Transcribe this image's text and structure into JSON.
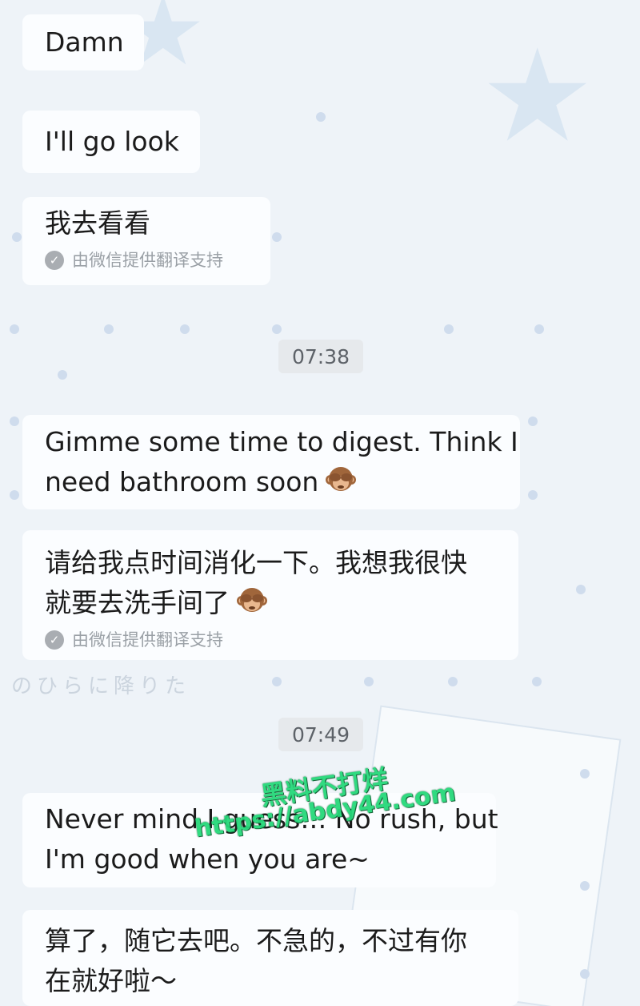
{
  "messages": {
    "m1": "Damn",
    "m2": "I'll go look",
    "m3": "我去看看",
    "m4_line1": "Gimme some time to digest. Think I",
    "m4_line2": "need bathroom soon",
    "m5_line1": "请给我点时间消化一下。我想我很快",
    "m5_line2": "就要去洗手间了",
    "m6_line1": "Never mind I guess… No rush, but",
    "m6_line2": "I'm good when you are~",
    "m7_line1": "算了，随它去吧。不急的，不过有你",
    "m7_line2": "在就好啦～"
  },
  "translation_note": "由微信提供翻译支持",
  "timestamps": {
    "t1": "07:38",
    "t2": "07:49"
  },
  "emoji": {
    "name": "see-no-evil-monkey"
  },
  "background_text": "のひらに降りた",
  "watermark": {
    "line1": "黑料不打烊",
    "line2": "https://abdy44.com"
  },
  "colors": {
    "bubble": "#fbfdff",
    "watermark": "#26d97a"
  }
}
